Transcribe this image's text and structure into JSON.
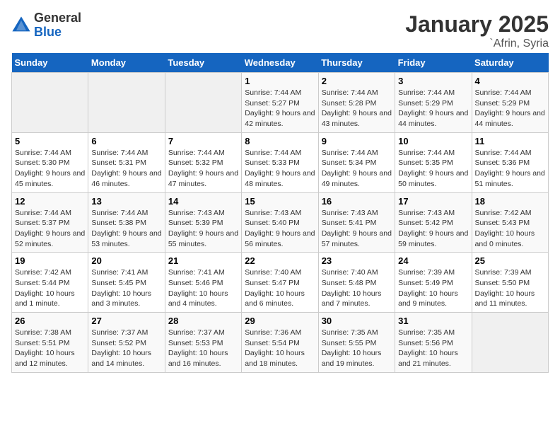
{
  "header": {
    "logo_general": "General",
    "logo_blue": "Blue",
    "month": "January 2025",
    "location": "`Afrin, Syria"
  },
  "weekdays": [
    "Sunday",
    "Monday",
    "Tuesday",
    "Wednesday",
    "Thursday",
    "Friday",
    "Saturday"
  ],
  "weeks": [
    [
      {
        "day": "",
        "info": ""
      },
      {
        "day": "",
        "info": ""
      },
      {
        "day": "",
        "info": ""
      },
      {
        "day": "1",
        "info": "Sunrise: 7:44 AM\nSunset: 5:27 PM\nDaylight: 9 hours and 42 minutes."
      },
      {
        "day": "2",
        "info": "Sunrise: 7:44 AM\nSunset: 5:28 PM\nDaylight: 9 hours and 43 minutes."
      },
      {
        "day": "3",
        "info": "Sunrise: 7:44 AM\nSunset: 5:29 PM\nDaylight: 9 hours and 44 minutes."
      },
      {
        "day": "4",
        "info": "Sunrise: 7:44 AM\nSunset: 5:29 PM\nDaylight: 9 hours and 44 minutes."
      }
    ],
    [
      {
        "day": "5",
        "info": "Sunrise: 7:44 AM\nSunset: 5:30 PM\nDaylight: 9 hours and 45 minutes."
      },
      {
        "day": "6",
        "info": "Sunrise: 7:44 AM\nSunset: 5:31 PM\nDaylight: 9 hours and 46 minutes."
      },
      {
        "day": "7",
        "info": "Sunrise: 7:44 AM\nSunset: 5:32 PM\nDaylight: 9 hours and 47 minutes."
      },
      {
        "day": "8",
        "info": "Sunrise: 7:44 AM\nSunset: 5:33 PM\nDaylight: 9 hours and 48 minutes."
      },
      {
        "day": "9",
        "info": "Sunrise: 7:44 AM\nSunset: 5:34 PM\nDaylight: 9 hours and 49 minutes."
      },
      {
        "day": "10",
        "info": "Sunrise: 7:44 AM\nSunset: 5:35 PM\nDaylight: 9 hours and 50 minutes."
      },
      {
        "day": "11",
        "info": "Sunrise: 7:44 AM\nSunset: 5:36 PM\nDaylight: 9 hours and 51 minutes."
      }
    ],
    [
      {
        "day": "12",
        "info": "Sunrise: 7:44 AM\nSunset: 5:37 PM\nDaylight: 9 hours and 52 minutes."
      },
      {
        "day": "13",
        "info": "Sunrise: 7:44 AM\nSunset: 5:38 PM\nDaylight: 9 hours and 53 minutes."
      },
      {
        "day": "14",
        "info": "Sunrise: 7:43 AM\nSunset: 5:39 PM\nDaylight: 9 hours and 55 minutes."
      },
      {
        "day": "15",
        "info": "Sunrise: 7:43 AM\nSunset: 5:40 PM\nDaylight: 9 hours and 56 minutes."
      },
      {
        "day": "16",
        "info": "Sunrise: 7:43 AM\nSunset: 5:41 PM\nDaylight: 9 hours and 57 minutes."
      },
      {
        "day": "17",
        "info": "Sunrise: 7:43 AM\nSunset: 5:42 PM\nDaylight: 9 hours and 59 minutes."
      },
      {
        "day": "18",
        "info": "Sunrise: 7:42 AM\nSunset: 5:43 PM\nDaylight: 10 hours and 0 minutes."
      }
    ],
    [
      {
        "day": "19",
        "info": "Sunrise: 7:42 AM\nSunset: 5:44 PM\nDaylight: 10 hours and 1 minute."
      },
      {
        "day": "20",
        "info": "Sunrise: 7:41 AM\nSunset: 5:45 PM\nDaylight: 10 hours and 3 minutes."
      },
      {
        "day": "21",
        "info": "Sunrise: 7:41 AM\nSunset: 5:46 PM\nDaylight: 10 hours and 4 minutes."
      },
      {
        "day": "22",
        "info": "Sunrise: 7:40 AM\nSunset: 5:47 PM\nDaylight: 10 hours and 6 minutes."
      },
      {
        "day": "23",
        "info": "Sunrise: 7:40 AM\nSunset: 5:48 PM\nDaylight: 10 hours and 7 minutes."
      },
      {
        "day": "24",
        "info": "Sunrise: 7:39 AM\nSunset: 5:49 PM\nDaylight: 10 hours and 9 minutes."
      },
      {
        "day": "25",
        "info": "Sunrise: 7:39 AM\nSunset: 5:50 PM\nDaylight: 10 hours and 11 minutes."
      }
    ],
    [
      {
        "day": "26",
        "info": "Sunrise: 7:38 AM\nSunset: 5:51 PM\nDaylight: 10 hours and 12 minutes."
      },
      {
        "day": "27",
        "info": "Sunrise: 7:37 AM\nSunset: 5:52 PM\nDaylight: 10 hours and 14 minutes."
      },
      {
        "day": "28",
        "info": "Sunrise: 7:37 AM\nSunset: 5:53 PM\nDaylight: 10 hours and 16 minutes."
      },
      {
        "day": "29",
        "info": "Sunrise: 7:36 AM\nSunset: 5:54 PM\nDaylight: 10 hours and 18 minutes."
      },
      {
        "day": "30",
        "info": "Sunrise: 7:35 AM\nSunset: 5:55 PM\nDaylight: 10 hours and 19 minutes."
      },
      {
        "day": "31",
        "info": "Sunrise: 7:35 AM\nSunset: 5:56 PM\nDaylight: 10 hours and 21 minutes."
      },
      {
        "day": "",
        "info": ""
      }
    ]
  ]
}
